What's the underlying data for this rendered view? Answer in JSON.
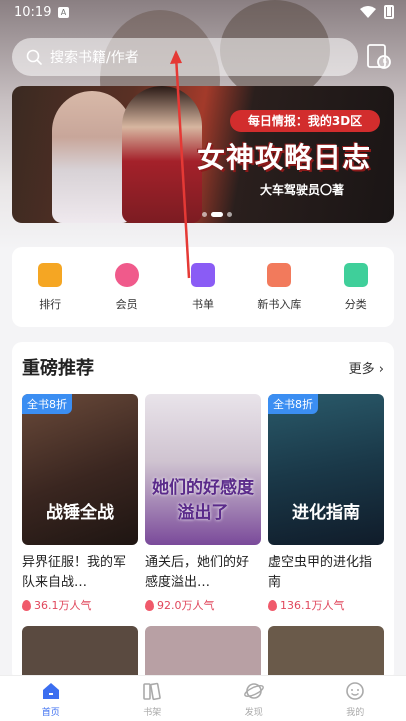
{
  "status_bar": {
    "time": "10:19",
    "notification_glyph": "A"
  },
  "search": {
    "placeholder": "搜索书籍/作者"
  },
  "banner": {
    "tagline": "每日情报：我的3D区",
    "title": "女神攻略日志",
    "author": "大车驾驶员〇著"
  },
  "quick_nav": [
    {
      "label": "排行",
      "icon": "ranking-icon",
      "color": "#f5a623"
    },
    {
      "label": "会员",
      "icon": "vip-icon",
      "color": "#f05a8b"
    },
    {
      "label": "书单",
      "icon": "booklist-icon",
      "color": "#8a5cf5"
    },
    {
      "label": "新书入库",
      "icon": "new-books-icon",
      "color": "#f27a5c"
    },
    {
      "label": "分类",
      "icon": "category-icon",
      "color": "#3fcf9a"
    }
  ],
  "recommend": {
    "title": "重磅推荐",
    "more": "更多 ›",
    "books": [
      {
        "cover_title": "战锤全战",
        "tag": "全书8折",
        "name": "异界征服！我的军队来自战…",
        "popularity": "36.1万人气"
      },
      {
        "cover_title": "她们的好感度溢出了",
        "tag": "",
        "name": "通关后，她们的好感度溢出…",
        "popularity": "92.0万人气"
      },
      {
        "cover_title": "进化指南",
        "tag": "全书8折",
        "name": "虚空虫甲的进化指南",
        "popularity": "136.1万人气"
      }
    ]
  },
  "tabbar": [
    {
      "label": "首页",
      "icon": "home-icon",
      "active": true
    },
    {
      "label": "书架",
      "icon": "bookshelf-icon",
      "active": false
    },
    {
      "label": "发现",
      "icon": "discover-icon",
      "active": false
    },
    {
      "label": "我的",
      "icon": "profile-icon",
      "active": false
    }
  ],
  "colors": {
    "accent": "#3b6ef0",
    "tag_blue": "#3b8ef2",
    "hot": "#e0475c"
  }
}
